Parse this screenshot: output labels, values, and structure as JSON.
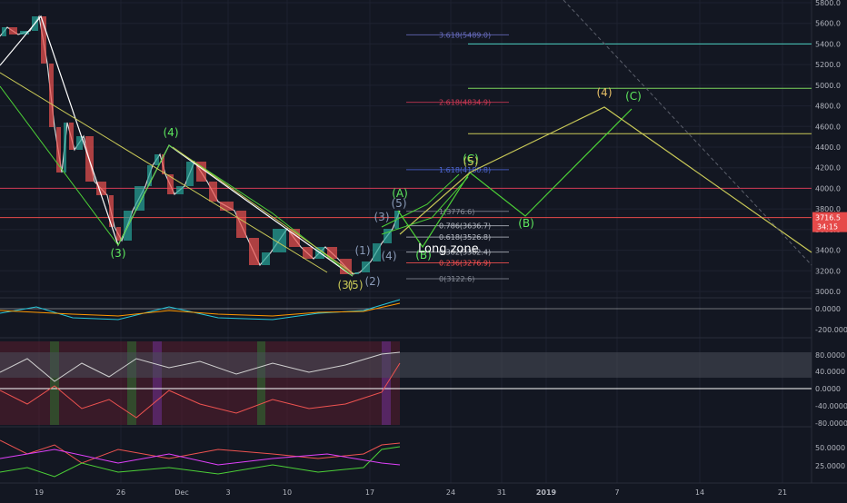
{
  "chart_data": {
    "type": "candlestick",
    "title": "",
    "price_axis": {
      "ticks": [
        "5800.0",
        "5600.0",
        "5400.0",
        "5200.0",
        "5000.0",
        "4800.0",
        "4600.0",
        "4400.0",
        "4200.0",
        "4000.0",
        "3800.0",
        "3600.0",
        "3400.0",
        "3200.0",
        "3000.0"
      ],
      "ylim": [
        3000,
        5800
      ],
      "last_price": "3716.5",
      "countdown": "34:15"
    },
    "time_axis": {
      "ticks": [
        "19",
        "26",
        "Dec",
        "3",
        "10",
        "17",
        "24",
        "31",
        "2019",
        "7",
        "14",
        "21"
      ]
    },
    "fib_levels": [
      {
        "label": "3.618(5489.0)",
        "value": 5489,
        "color": "#6b6fc4"
      },
      {
        "label": "2.618(4834.9)",
        "value": 4835,
        "color": "#d13a55"
      },
      {
        "label": "1.618(4180.8)",
        "value": 4181,
        "color": "#4e67d6"
      },
      {
        "label": "1(3776.6)",
        "value": 3777,
        "color": "#8a8f9b"
      },
      {
        "label": "0.786(3636.7)",
        "value": 3637,
        "color": "#b8bcc6"
      },
      {
        "label": "0.618(3526.8)",
        "value": 3527,
        "color": "#b8bcc6"
      },
      {
        "label": "0.382(3382.4)",
        "value": 3382,
        "color": "#b8bcc6"
      },
      {
        "label": "0.236(3276.9)",
        "value": 3277,
        "color": "#ff5252"
      },
      {
        "label": "0(3122.6)",
        "value": 3123,
        "color": "#8a8f9b"
      }
    ],
    "horizontal_levels": [
      {
        "value": 5400,
        "color": "#4dd0c1"
      },
      {
        "value": 4970,
        "color": "#7cd65c"
      },
      {
        "value": 4530,
        "color": "#c9c957"
      },
      {
        "value": 4000,
        "color": "#d13a55"
      },
      {
        "value": 3716.5,
        "color": "#e64a4a"
      }
    ],
    "wave_labels": [
      {
        "text": "(3)",
        "color": "#5ee85e"
      },
      {
        "text": "(4)",
        "color": "#5ee85e"
      },
      {
        "text": "(3)",
        "color": "#c9c957"
      },
      {
        "text": "(5)",
        "color": "#c9c957"
      },
      {
        "text": "(1)",
        "color": "#8a9bb8"
      },
      {
        "text": "(2)",
        "color": "#8a9bb8"
      },
      {
        "text": "(3)",
        "color": "#8a9bb8"
      },
      {
        "text": "(4)",
        "color": "#8a9bb8"
      },
      {
        "text": "(5)",
        "color": "#8a9bb8"
      },
      {
        "text": "(A)",
        "color": "#5ee85e"
      },
      {
        "text": "(B)",
        "color": "#5ee85e"
      },
      {
        "text": "(C)",
        "color": "#5ee85e"
      },
      {
        "text": "(5)",
        "color": "#c9c957"
      },
      {
        "text": "(B)",
        "color": "#5ee85e"
      },
      {
        "text": "(4)",
        "color": "#e8c067"
      },
      {
        "text": "(C)",
        "color": "#5ee85e"
      }
    ],
    "annotation": "Long zone",
    "indicator_panels": [
      {
        "name": "macd",
        "ticks": [
          "0.0000",
          "-200.0000"
        ]
      },
      {
        "name": "stoch",
        "ticks": [
          "80.0000",
          "40.0000",
          "0.0000",
          "-40.0000",
          "-80.0000"
        ]
      },
      {
        "name": "rsi",
        "ticks": [
          "50.0000",
          "25.0000"
        ]
      }
    ]
  }
}
